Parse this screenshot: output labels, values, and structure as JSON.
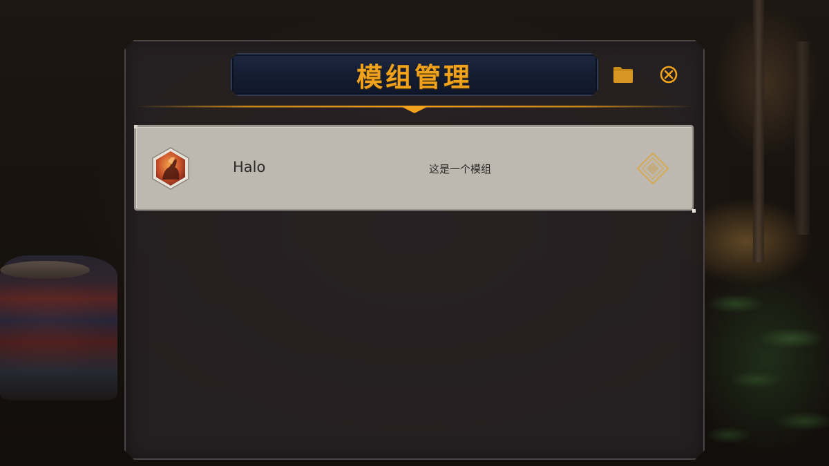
{
  "dialog": {
    "title": "模组管理",
    "folder_icon": "folder-icon",
    "close_icon": "close-icon"
  },
  "mods": [
    {
      "icon": "mod-portrait-icon",
      "name": "Halo",
      "description": "这是一个模组",
      "toggle_icon": "diamond-toggle-icon"
    }
  ],
  "colors": {
    "accent": "#f0a21c",
    "title_bar": "#141c30",
    "panel": "#2a2426",
    "row_bg": "#bdb8b0",
    "row_text": "#2c2a28"
  }
}
